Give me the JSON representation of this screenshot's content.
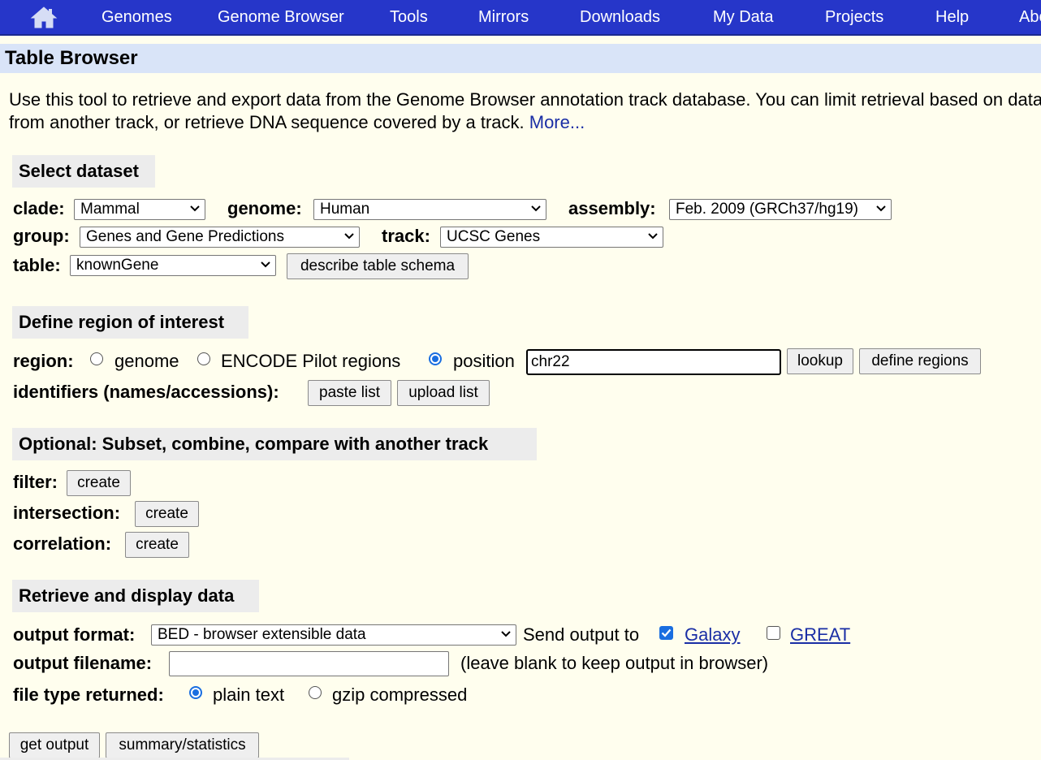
{
  "nav": {
    "home_icon": "home-icon",
    "items": [
      "Genomes",
      "Genome Browser",
      "Tools",
      "Mirrors",
      "Downloads",
      "My Data",
      "Projects",
      "Help",
      "About Us"
    ]
  },
  "page": {
    "title": "Table Browser",
    "intro_line1": "Use this tool to retrieve and export data from the Genome Browser annotation track database. You can limit retrieval based on data",
    "intro_line2": "from another track, or retrieve DNA sequence covered by a track.",
    "more_link": "More..."
  },
  "select_dataset": {
    "heading": "Select dataset",
    "clade_label": "clade:",
    "clade_value": "Mammal",
    "genome_label": "genome:",
    "genome_value": "Human",
    "assembly_label": "assembly:",
    "assembly_value": "Feb. 2009 (GRCh37/hg19)",
    "group_label": "group:",
    "group_value": "Genes and Gene Predictions",
    "track_label": "track:",
    "track_value": "UCSC Genes",
    "table_label": "table:",
    "table_value": "knownGene",
    "describe_button": "describe table schema"
  },
  "region": {
    "heading": "Define region of interest",
    "region_label": "region:",
    "opt_genome": "genome",
    "opt_encode": "ENCODE Pilot regions",
    "opt_position": "position",
    "selected": "position",
    "position_value": "chr22",
    "lookup_button": "lookup",
    "define_button": "define regions",
    "identifiers_label": "identifiers (names/accessions):",
    "paste_button": "paste list",
    "upload_button": "upload list"
  },
  "optional": {
    "heading": "Optional: Subset, combine, compare with another track",
    "filter_label": "filter:",
    "intersection_label": "intersection:",
    "correlation_label": "correlation:",
    "create_label": "create"
  },
  "retrieve": {
    "heading": "Retrieve and display data",
    "output_format_label": "output format:",
    "output_format_value": "BED - browser extensible data",
    "send_output_label": "Send output to",
    "galaxy_label": "Galaxy",
    "galaxy_checked": true,
    "great_label": "GREAT",
    "great_checked": false,
    "filename_label": "output filename:",
    "filename_value": "",
    "filename_hint": "(leave blank to keep output in browser)",
    "filetype_label": "file type returned:",
    "opt_plain": "plain text",
    "opt_gzip": "gzip compressed",
    "filetype_selected": "plain text",
    "get_output_button": "get output",
    "summary_button": "summary/statistics"
  },
  "colors": {
    "nav_bg": "#2636c9",
    "page_bg": "#fffeee",
    "title_bg": "#d9e4f8",
    "section_bg": "#ececec",
    "link": "#1a2ea5",
    "accent": "#1a6ee0"
  }
}
